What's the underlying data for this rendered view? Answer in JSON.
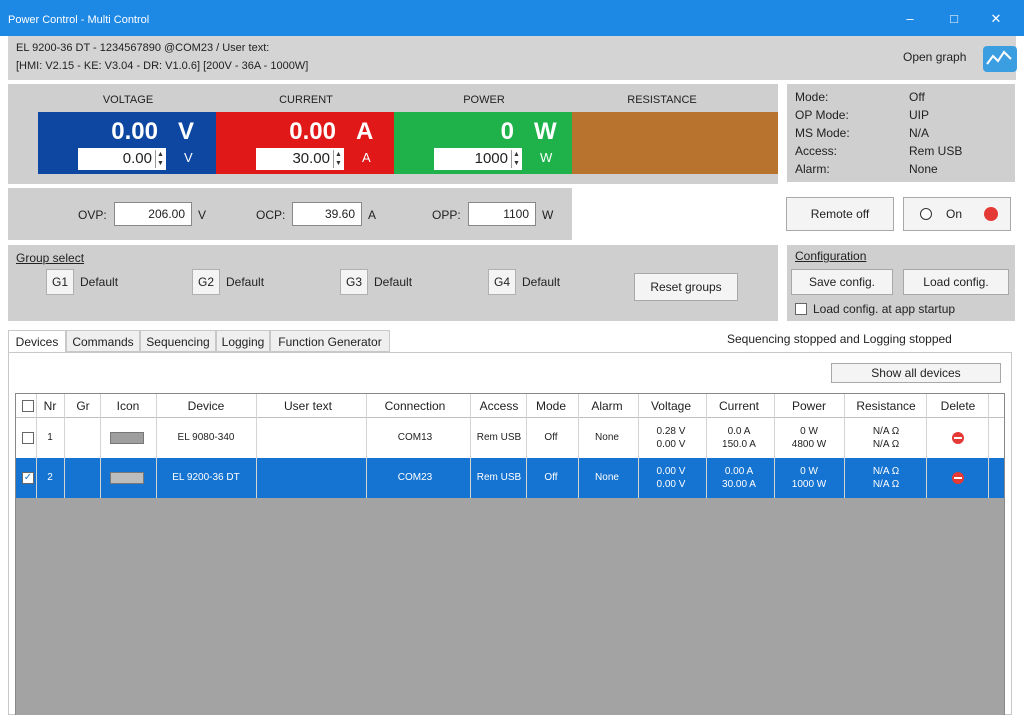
{
  "window": {
    "title": "Power Control - Multi Control",
    "minimize": "–",
    "maximize": "□",
    "close": "✕"
  },
  "device_info": {
    "line1": "EL 9200-36 DT - 1234567890 @COM23 / User text:",
    "line2": "[HMI: V2.15 - KE: V3.04 - DR: V1.0.6] [200V - 36A - 1000W]",
    "open_graph": "Open graph"
  },
  "meters": [
    {
      "label": "VOLTAGE",
      "value": "0.00",
      "unit": "V",
      "set": "0.00",
      "set_unit": "V",
      "color": "#0d47a1"
    },
    {
      "label": "CURRENT",
      "value": "0.00",
      "unit": "A",
      "set": "30.00",
      "set_unit": "A",
      "color": "#e01818"
    },
    {
      "label": "POWER",
      "value": "0",
      "unit": "W",
      "set": "1000",
      "set_unit": "W",
      "color": "#1fb14a"
    },
    {
      "label": "RESISTANCE",
      "color": "#b8732f"
    }
  ],
  "status": {
    "mode_label": "Mode:",
    "mode": "Off",
    "op_label": "OP Mode:",
    "op": "UIP",
    "ms_label": "MS Mode:",
    "ms": "N/A",
    "access_label": "Access:",
    "access": "Rem USB",
    "alarm_label": "Alarm:",
    "alarm": "None"
  },
  "protection": {
    "ovp_label": "OVP:",
    "ovp": "206.00",
    "ovp_unit": "V",
    "ocp_label": "OCP:",
    "ocp": "39.60",
    "ocp_unit": "A",
    "opp_label": "OPP:",
    "opp": "1100",
    "opp_unit": "W"
  },
  "remote": {
    "remote_off": "Remote off",
    "on_label": "On",
    "led_color": "#e53935"
  },
  "groups": {
    "title": "Group select",
    "items": [
      {
        "tag": "G1",
        "name": "Default"
      },
      {
        "tag": "G2",
        "name": "Default"
      },
      {
        "tag": "G3",
        "name": "Default"
      },
      {
        "tag": "G4",
        "name": "Default"
      }
    ],
    "reset": "Reset groups"
  },
  "config": {
    "title": "Configuration",
    "save": "Save config.",
    "load": "Load config.",
    "startup": "Load config. at app startup"
  },
  "tabs": [
    "Devices",
    "Commands",
    "Sequencing",
    "Logging",
    "Function Generator"
  ],
  "sequencing_status": "Sequencing stopped and Logging stopped",
  "show_all": "Show all devices",
  "table": {
    "headers": [
      "Nr",
      "Gr",
      "Icon",
      "Device",
      "User text",
      "Connection",
      "Access",
      "Mode",
      "Alarm",
      "Voltage",
      "Current",
      "Power",
      "Resistance",
      "Delete"
    ],
    "rows": [
      {
        "nr": "1",
        "gr": "",
        "device": "EL 9080-340",
        "user_text": "",
        "connection": "COM13",
        "access": "Rem USB",
        "mode": "Off",
        "alarm": "None",
        "voltage1": "0.28 V",
        "voltage2": "0.00 V",
        "current1": "0.0 A",
        "current2": "150.0 A",
        "power1": "0 W",
        "power2": "4800 W",
        "res1": "N/A Ω",
        "res2": "N/A Ω",
        "checked": false
      },
      {
        "nr": "2",
        "gr": "",
        "device": "EL 9200-36 DT",
        "user_text": "",
        "connection": "COM23",
        "access": "Rem USB",
        "mode": "Off",
        "alarm": "None",
        "voltage1": "0.00 V",
        "voltage2": "0.00 V",
        "current1": "0.00 A",
        "current2": "30.00 A",
        "power1": "0 W",
        "power2": "1000 W",
        "res1": "N/A Ω",
        "res2": "N/A Ω",
        "checked": true
      }
    ]
  }
}
